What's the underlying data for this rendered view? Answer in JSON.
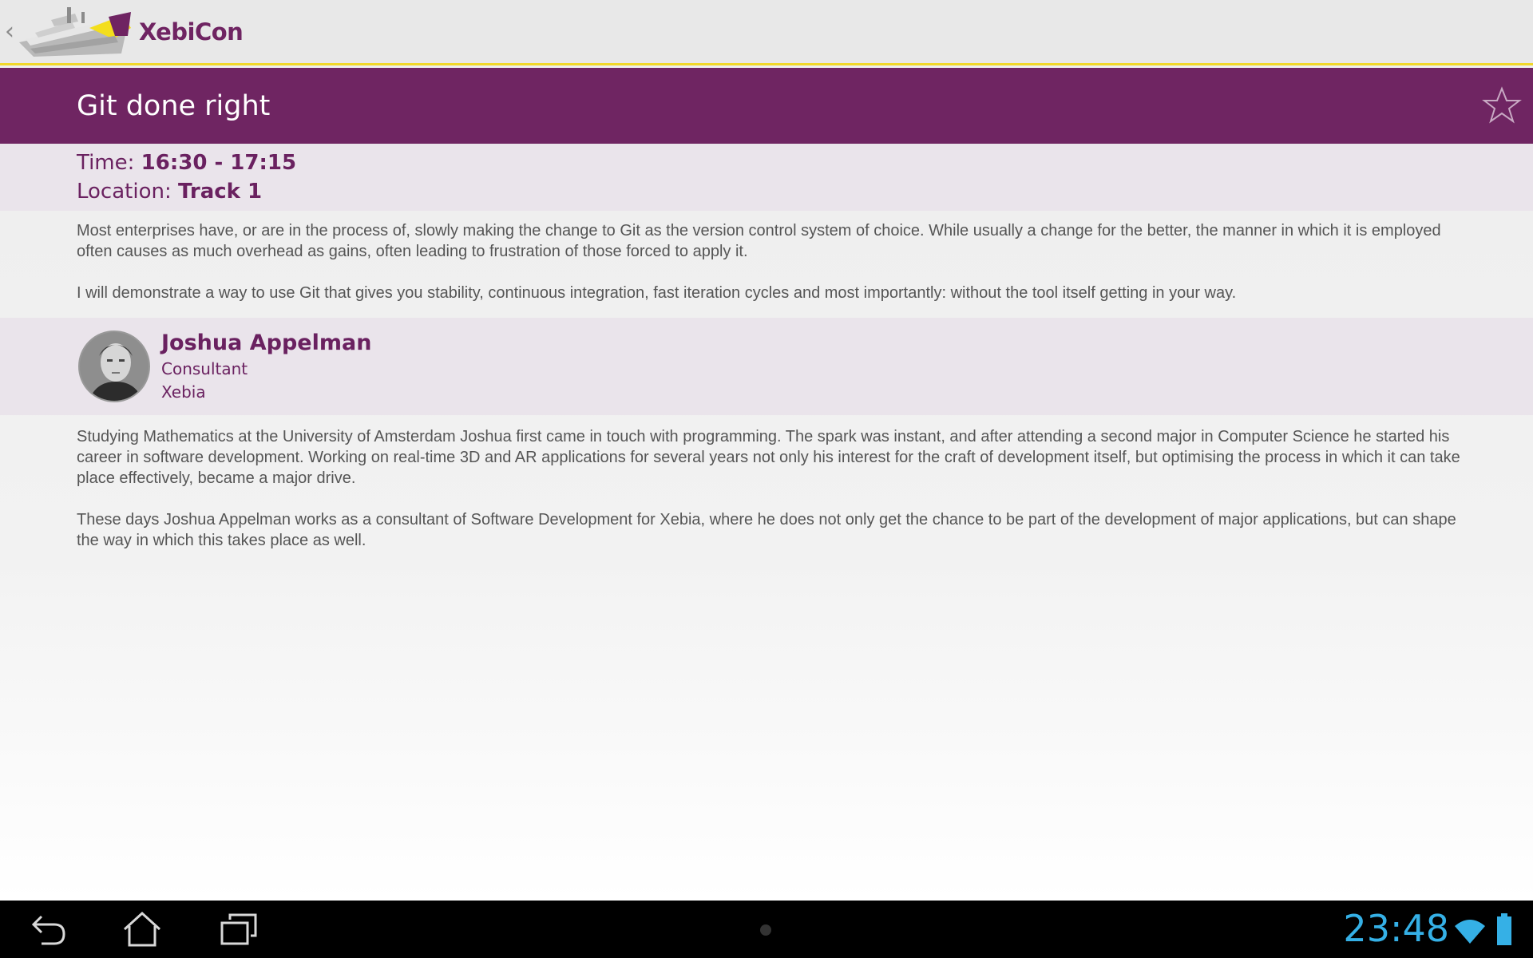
{
  "header": {
    "app_name": "XebiCon",
    "accent_color": "#6f2462",
    "divider_color": "#f0d82a"
  },
  "session": {
    "title": "Git done right",
    "time_label": "Time:",
    "time_value": "16:30 - 17:15",
    "location_label": "Location:",
    "location_value": "Track 1",
    "favorite_icon": "star-outline-icon",
    "description": [
      "Most enterprises have, or are in the process of, slowly making the change to Git as the version control system of choice. While usually a change for the better, the manner in which it is employed often causes as much overhead as gains, often leading to frustration of those forced to apply it.",
      "I will demonstrate a way to use Git that gives you stability, continuous integration, fast iteration cycles and most importantly: without the tool itself getting in your way."
    ]
  },
  "speaker": {
    "name": "Joshua Appelman",
    "role": "Consultant",
    "company": "Xebia",
    "bio": [
      "Studying Mathematics at the University of Amsterdam Joshua first came in touch with programming. The spark was instant, and after attending a second major in Computer Science he started his career in software development. Working on real-time 3D and AR applications for several years not only his interest for the craft of development itself, but optimising the process in which it can take place effectively, became a major drive.",
      "These days Joshua Appelman works as a consultant of Software Development for Xebia, where he does not only get the chance to be part of the development of major applications, but can shape the way in which this takes place as well."
    ]
  },
  "system_bar": {
    "time": "23:48",
    "time_color": "#35b0e6",
    "icons": [
      "back-icon",
      "home-icon",
      "recent-apps-icon",
      "wifi-icon",
      "battery-icon"
    ]
  }
}
